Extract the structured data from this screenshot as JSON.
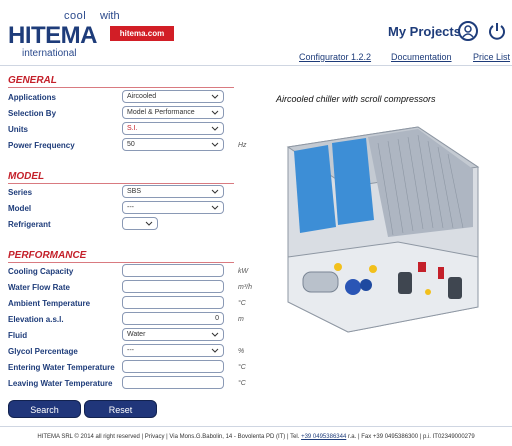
{
  "header": {
    "logo_cool": "cool",
    "logo_with": "with",
    "logo_brand": "HITEMA",
    "logo_international": "international",
    "site_badge": "hitema.com",
    "my_projects": "My Projects",
    "links": [
      "Configurator 1.2.2",
      "Documentation",
      "Price List"
    ]
  },
  "general": {
    "title": "GENERAL",
    "fields": [
      {
        "label": "Applications",
        "value": "Aircooled"
      },
      {
        "label": "Selection By",
        "value": "Model & Performance"
      },
      {
        "label": "Units",
        "value": "S.I."
      },
      {
        "label": "Power Frequency",
        "value": "50",
        "unit": "Hz"
      }
    ]
  },
  "model": {
    "title": "MODEL",
    "fields": [
      {
        "label": "Series",
        "value": "SBS"
      },
      {
        "label": "Model",
        "value": "---"
      },
      {
        "label": "Refrigerant",
        "value": ""
      }
    ]
  },
  "performance": {
    "title": "PERFORMANCE",
    "fields": [
      {
        "label": "Cooling Capacity",
        "value": "",
        "unit": "kW"
      },
      {
        "label": "Water Flow Rate",
        "value": "",
        "unit": "m³/h"
      },
      {
        "label": "Ambient Temperature",
        "value": "",
        "unit": "°C"
      },
      {
        "label": "Elevation a.s.l.",
        "value": "0",
        "unit": "m"
      },
      {
        "label": "Fluid",
        "value": "Water"
      },
      {
        "label": "Glycol Percentage",
        "value": "---",
        "unit": "%"
      },
      {
        "label": "Entering Water Temperature",
        "value": "",
        "unit": "°C"
      },
      {
        "label": "Leaving Water Temperature",
        "value": "",
        "unit": "°C"
      }
    ]
  },
  "buttons": {
    "search": "Search",
    "reset": "Reset"
  },
  "image_caption": "Aircooled chiller with scroll compressors",
  "footer": {
    "text_before": "HITEMA SRL © 2014 all right reserved | Privacy | Via Mons.G.Babolin, 14 - Bovolenta PD (IT) | Tel. ",
    "tel": "+39 0495386344",
    "text_after": " r.a. | Fax +39 0495386300 | p.i. IT02349000279"
  },
  "colors": {
    "brand_blue": "#1e3c7a",
    "section_red": "#c4202a",
    "button_blue": "#20367a",
    "panel_blue": "#3d8ed6"
  },
  "icons": [
    "user-icon",
    "power-icon",
    "chevron-down-icon"
  ]
}
